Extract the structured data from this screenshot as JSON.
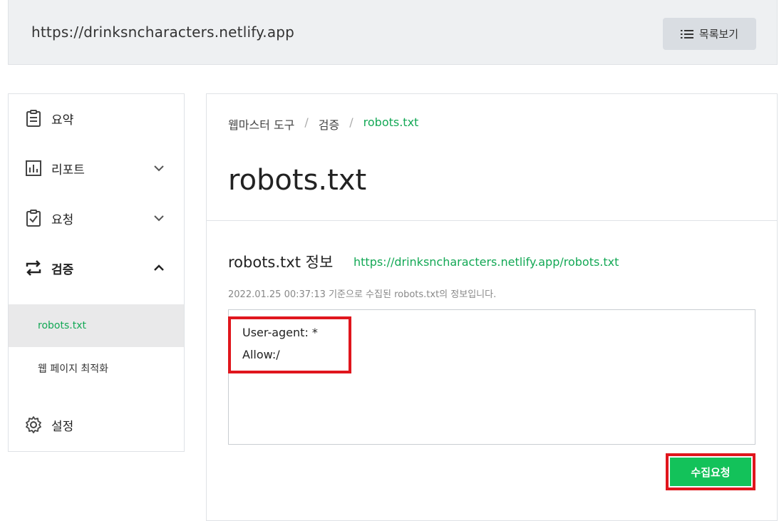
{
  "header": {
    "site_url": "https://drinksncharacters.netlify.app",
    "list_button_label": "목록보기",
    "list_icon": "list-icon"
  },
  "sidebar": {
    "items": [
      {
        "label": "요약",
        "icon": "clipboard-icon"
      },
      {
        "label": "리포트",
        "icon": "bar-chart-icon",
        "chevron": "chevron-down-icon"
      },
      {
        "label": "요청",
        "icon": "clipboard-check-icon",
        "chevron": "chevron-down-icon"
      },
      {
        "label": "검증",
        "icon": "swap-arrows-icon",
        "chevron": "chevron-up-icon",
        "expanded": true
      },
      {
        "label": "설정",
        "icon": "gear-icon"
      }
    ],
    "sub_items": [
      {
        "label": "robots.txt",
        "active": true
      },
      {
        "label": "웹 페이지 최적화",
        "active": false
      }
    ]
  },
  "main": {
    "breadcrumb": [
      "웹마스터 도구",
      "검증",
      "robots.txt"
    ],
    "breadcrumb_separator": "/",
    "page_title": "robots.txt",
    "section_title": "robots.txt 정보",
    "robots_url": "https://drinksncharacters.netlify.app/robots.txt",
    "info_note": "2022.01.25 00:37:13 기준으로 수집된 robots.txt의 정보입니다.",
    "robots_content": [
      "User-agent: *",
      "Allow:/"
    ],
    "fetch_button_label": "수집요청"
  },
  "colors": {
    "accent_green": "#13a855",
    "button_green": "#13c25a",
    "highlight_red": "#e0161d"
  }
}
